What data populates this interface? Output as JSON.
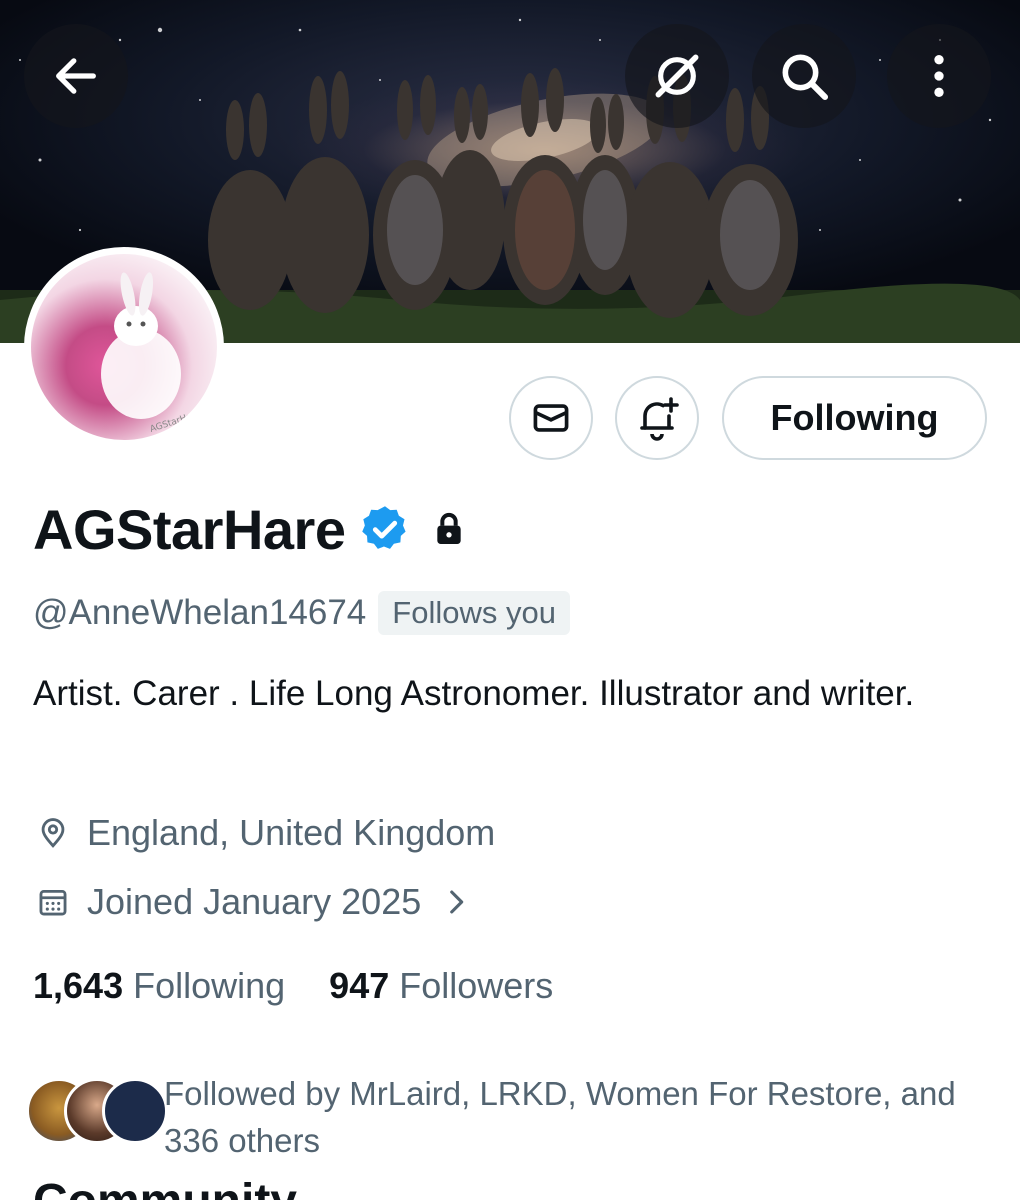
{
  "banner": {
    "nav": {
      "back_icon": "arrow-left-icon",
      "grok_icon": "slashed-circle-icon",
      "search_icon": "search-icon",
      "more_icon": "more-vertical-icon"
    }
  },
  "actions": {
    "message_icon": "envelope-icon",
    "notify_icon": "bell-plus-icon",
    "following_label": "Following"
  },
  "profile": {
    "name": "AGStarHare",
    "handle": "@AnneWhelan14674",
    "follows_you": "Follows you",
    "bio": "Artist. Carer . Life Long Astronomer. Illustrator and writer.",
    "location": "England, United Kingdom",
    "joined": "Joined January 2025",
    "avatar_watermark": "AGStarHare"
  },
  "stats": {
    "following_count": "1,643",
    "following_label": "Following",
    "followers_count": "947",
    "followers_label": "Followers"
  },
  "followed_by": {
    "text": "Followed by MrLaird, LRKD, Women For Restore, and 336 others"
  },
  "section_peek": "Community"
}
